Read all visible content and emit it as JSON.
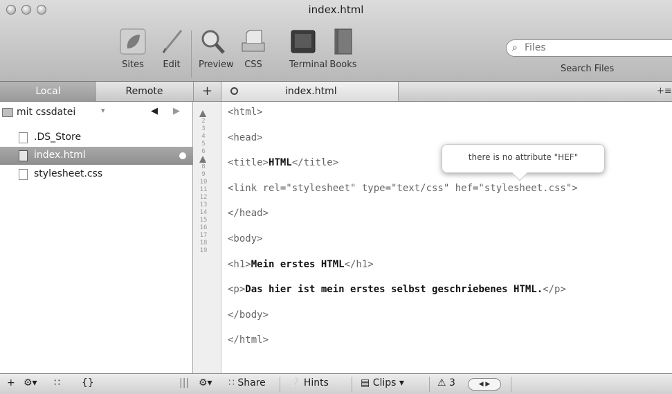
{
  "window": {
    "title": "index.html"
  },
  "toolbar": {
    "sites_label": "Sites",
    "edit_label": "Edit",
    "preview_label": "Preview",
    "css_label": "CSS",
    "terminal_label": "Terminal",
    "books_label": "Books",
    "search_placeholder": "Files",
    "search_label": "Search Files"
  },
  "tabs": {
    "local_label": "Local",
    "remote_label": "Remote",
    "add_label": "+",
    "open_file": "index.html",
    "menu_label": "+≡"
  },
  "sidebar": {
    "folder": "mit cssdatei",
    "files": [
      {
        "name": ".DS_Store",
        "selected": false
      },
      {
        "name": "index.html",
        "selected": true
      },
      {
        "name": "stylesheet.css",
        "selected": false
      }
    ]
  },
  "editor": {
    "line_numbers": [
      "1",
      "2",
      "3",
      "4",
      "5",
      "6",
      "7",
      "8",
      "9",
      "10",
      "11",
      "12",
      "13",
      "14",
      "15",
      "16",
      "17",
      "18",
      "19"
    ],
    "warning_lines": [
      1,
      7
    ],
    "lines": [
      {
        "pre": "<html>",
        "bold": "",
        "post": ""
      },
      {
        "pre": "<head>",
        "bold": "",
        "post": ""
      },
      {
        "pre": "<title>",
        "bold": "HTML",
        "post": "</title>"
      },
      {
        "pre": "<link rel=\"stylesheet\" type=\"text/css\" hef=\"stylesheet.css\">",
        "bold": "",
        "post": ""
      },
      {
        "pre": "</head>",
        "bold": "",
        "post": ""
      },
      {
        "pre": "<body>",
        "bold": "",
        "post": ""
      },
      {
        "pre": "<h1>",
        "bold": "Mein erstes HTML",
        "post": "</h1>"
      },
      {
        "pre": "<p>",
        "bold": "Das hier ist mein erstes selbst geschriebenes HTML.",
        "post": "</p>"
      },
      {
        "pre": "</body>",
        "bold": "",
        "post": ""
      },
      {
        "pre": "</html>",
        "bold": "",
        "post": ""
      }
    ],
    "tooltip": "there is no attribute \"HEF\""
  },
  "bottombar": {
    "add": "+",
    "share_label": "Share",
    "hints_label": "Hints",
    "clips_label": "Clips",
    "warning_count": "3"
  }
}
